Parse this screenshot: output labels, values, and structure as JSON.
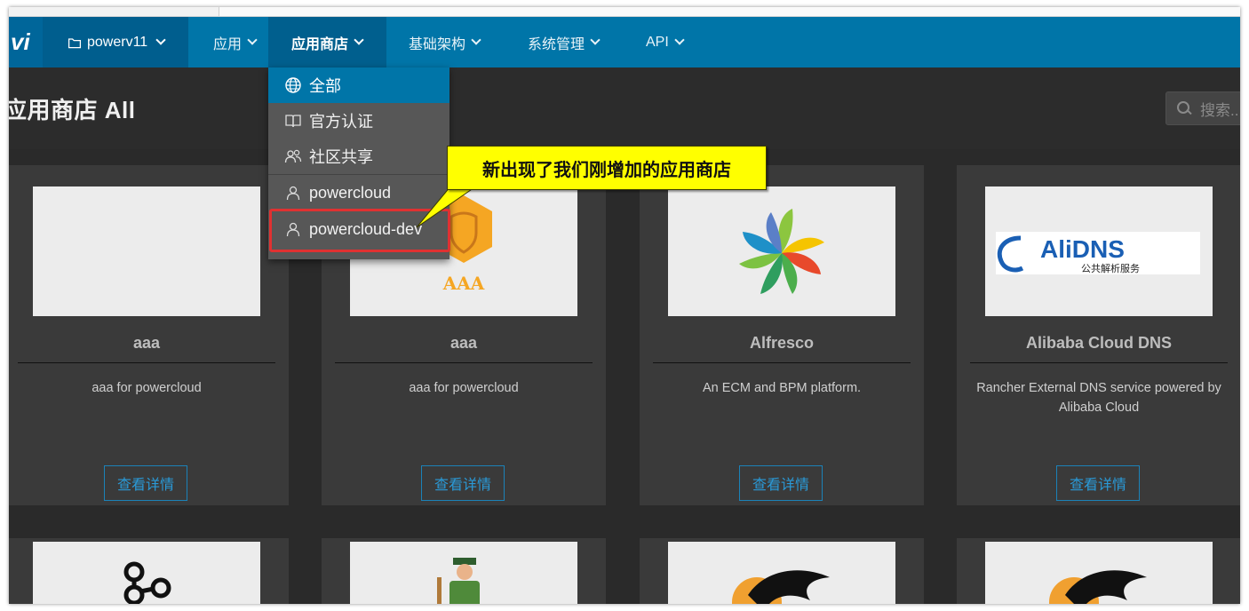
{
  "env": {
    "name": "powerv11"
  },
  "nav": {
    "logo_text": "vi",
    "items": [
      {
        "label": "应用"
      },
      {
        "label": "应用商店"
      },
      {
        "label": "基础架构"
      },
      {
        "label": "系统管理"
      },
      {
        "label": "API"
      }
    ]
  },
  "page": {
    "title": "应用商店 All"
  },
  "search": {
    "placeholder": "搜索..."
  },
  "dropdown": {
    "items": [
      {
        "label": "全部",
        "icon": "globe-icon"
      },
      {
        "label": "官方认证",
        "icon": "book-icon"
      },
      {
        "label": "社区共享",
        "icon": "users-icon"
      },
      {
        "label": "powercloud",
        "icon": "user-icon"
      },
      {
        "label": "powercloud-dev",
        "icon": "user-icon"
      }
    ]
  },
  "callout": {
    "text": "新出现了我们刚增加的应用商店"
  },
  "cards": [
    {
      "name": "aaa",
      "desc": "aaa for powercloud",
      "button": "查看详情"
    },
    {
      "name": "aaa",
      "desc": "aaa for powercloud",
      "button": "查看详情",
      "logo_text": "AAA"
    },
    {
      "name": "Alfresco",
      "desc": "An ECM and BPM platform.",
      "button": "查看详情"
    },
    {
      "name": "Alibaba Cloud DNS",
      "desc": "Rancher External DNS service powered by Alibaba Cloud",
      "button": "查看详情",
      "logo_main": "AliDNS",
      "logo_sub": "公共解析服务"
    }
  ],
  "colors": {
    "navbar": "#0075a8",
    "accent": "#2a9ad8",
    "highlight": "#e03131",
    "callout": "#ffff00"
  }
}
